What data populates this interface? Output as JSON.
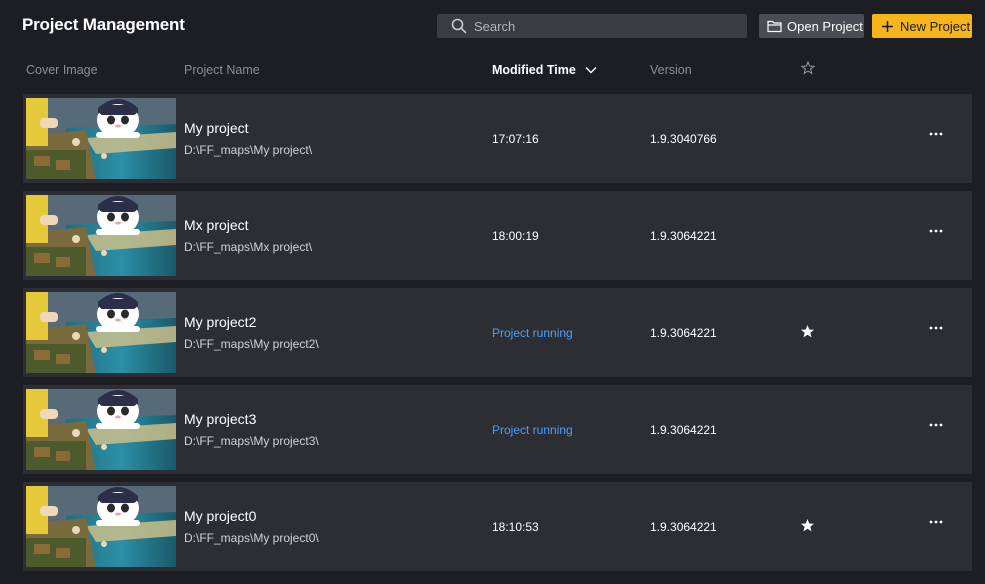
{
  "header": {
    "title": "Project Management",
    "search_placeholder": "Search",
    "open_project_label": "Open Project",
    "new_project_label": "New Project"
  },
  "columns": {
    "cover": "Cover Image",
    "name": "Project Name",
    "modified": "Modified Time",
    "version": "Version",
    "favorite_icon": "star-outline-icon"
  },
  "projects": [
    {
      "name": "My project",
      "path": "D:\\FF_maps\\My project\\",
      "time": "17:07:16",
      "running": false,
      "version": "1.9.3040766",
      "favorite": false
    },
    {
      "name": "Mx project",
      "path": "D:\\FF_maps\\Mx project\\",
      "time": "18:00:19",
      "running": false,
      "version": "1.9.3064221",
      "favorite": false
    },
    {
      "name": "My project2",
      "path": "D:\\FF_maps\\My project2\\",
      "time": "Project running",
      "running": true,
      "version": "1.9.3064221",
      "favorite": true
    },
    {
      "name": "My project3",
      "path": "D:\\FF_maps\\My project3\\",
      "time": "Project running",
      "running": true,
      "version": "1.9.3064221",
      "favorite": false
    },
    {
      "name": "My project0",
      "path": "D:\\FF_maps\\My project0\\",
      "time": "18:10:53",
      "running": false,
      "version": "1.9.3064221",
      "favorite": true
    }
  ],
  "colors": {
    "background": "#1d1e23",
    "row": "#2c2e33",
    "accent": "#f5b51d",
    "running": "#4a9eff"
  }
}
